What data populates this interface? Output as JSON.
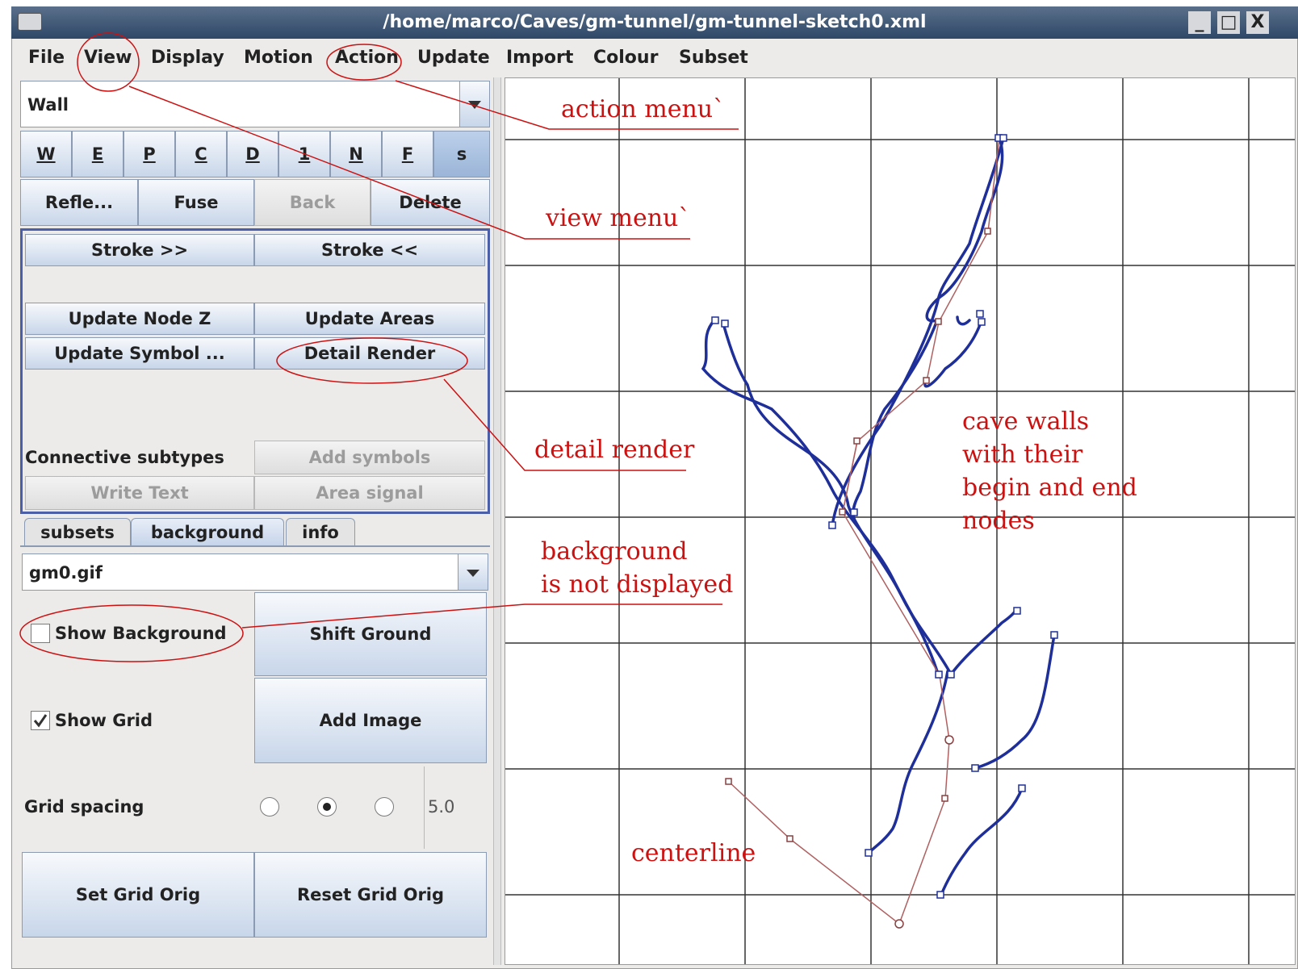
{
  "window": {
    "title": "/home/marco/Caves/gm-tunnel/gm-tunnel-sketch0.xml",
    "controls": [
      "_",
      "□",
      "X"
    ]
  },
  "menubar": {
    "items": [
      "File",
      "View",
      "Display",
      "Motion",
      "Action",
      "Update",
      "Import",
      "Colour",
      "Subset"
    ]
  },
  "panel": {
    "type_combo": "Wall",
    "letter_buttons": [
      "W",
      "E",
      "P",
      "C",
      "D",
      "1",
      "N",
      "F",
      "s"
    ],
    "action_buttons": [
      "Refle...",
      "Fuse",
      "Back",
      "Delete"
    ],
    "stroke_forward": "Stroke >>",
    "stroke_back": "Stroke <<",
    "update_node_z": "Update Node Z",
    "update_areas": "Update Areas",
    "update_symbol": "Update Symbol ...",
    "detail_render": "Detail Render",
    "connective_label": "Connective subtypes",
    "add_symbols": "Add symbols",
    "write_text": "Write Text",
    "area_signal": "Area signal"
  },
  "tabs": [
    "subsets",
    "background",
    "info"
  ],
  "background_tab": {
    "image_combo": "gm0.gif",
    "show_background_label": "Show Background",
    "show_background_checked": false,
    "shift_ground": "Shift Ground",
    "show_grid_label": "Show Grid",
    "show_grid_checked": true,
    "add_image": "Add Image",
    "grid_spacing_label": "Grid spacing",
    "grid_spacing_selected_index": 1,
    "grid_spacing_value": "5.0",
    "set_grid_orig": "Set Grid Orig",
    "reset_grid_orig": "Reset Grid Orig"
  },
  "annotations": {
    "action_menu": "action menu`",
    "view_menu": "view menu`",
    "detail_render": "detail render",
    "cave_walls": [
      "cave walls",
      "with their",
      "begin and end",
      "nodes"
    ],
    "background": [
      "background",
      "is not displayed"
    ],
    "centerline": "centerline"
  },
  "colors": {
    "wall_stroke": "#1f2f9a",
    "centerline_stroke": "#b06060",
    "annotation": "#cc1111",
    "grid": "#333333"
  }
}
